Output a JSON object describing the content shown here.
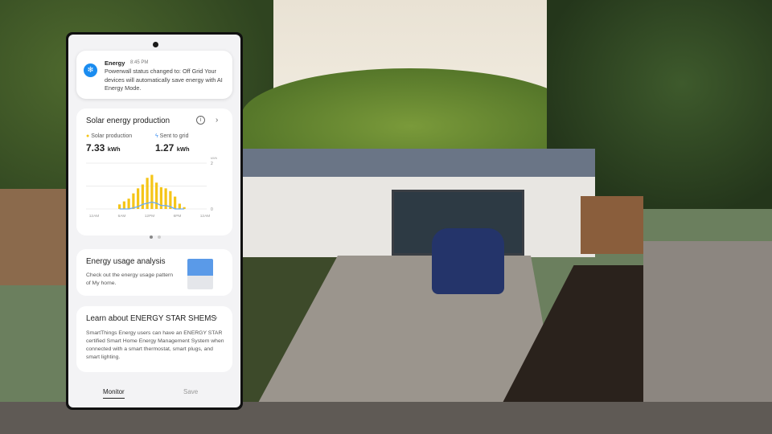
{
  "notification": {
    "app": "Energy",
    "time": "8:45 PM",
    "message": "Powerwall status changed to: Off Grid Your devices will automatically save energy with AI Energy Mode.",
    "icon": "snowflake-icon"
  },
  "solar": {
    "title": "Solar energy production",
    "production_label": "Solar production",
    "production_value": "7.33",
    "production_unit": "kWh",
    "grid_label": "Sent to grid",
    "grid_value": "1.27",
    "grid_unit": "kWh",
    "page": 1,
    "pages": 2
  },
  "chart_data": {
    "type": "bar",
    "unit_label": "kWh",
    "ylim": [
      0,
      2
    ],
    "yticks": [
      "2",
      "0"
    ],
    "xticks": [
      "12AM",
      "6AM",
      "12PM",
      "6PM",
      "12AM"
    ],
    "hours": [
      5,
      6,
      7,
      8,
      9,
      10,
      11,
      12,
      13,
      14,
      15,
      16,
      17,
      18,
      19
    ],
    "series": [
      {
        "name": "Solar production",
        "type": "bar",
        "color": "#f5c518",
        "values": [
          0.2,
          0.33,
          0.45,
          0.68,
          0.9,
          1.07,
          1.36,
          1.49,
          1.15,
          0.95,
          0.9,
          0.78,
          0.54,
          0.23,
          0.08
        ]
      },
      {
        "name": "Sent to grid",
        "type": "line",
        "color": "#6aaaf0",
        "values": [
          0,
          0,
          0,
          0.05,
          0.1,
          0.2,
          0.25,
          0.3,
          0.25,
          0.15,
          0.15,
          0.1,
          0,
          0,
          0
        ]
      }
    ]
  },
  "usage": {
    "title": "Energy usage analysis",
    "desc": "Check out the energy usage pattern of My home."
  },
  "learn": {
    "title": "Learn about ENERGY STAR SHEMS",
    "desc": "SmartThings Energy users can have an ENERGY STAR certified Smart Home Energy Management System when connected with a smart thermostat, smart plugs, and smart lighting."
  },
  "tabs": {
    "monitor": "Monitor",
    "save": "Save"
  }
}
